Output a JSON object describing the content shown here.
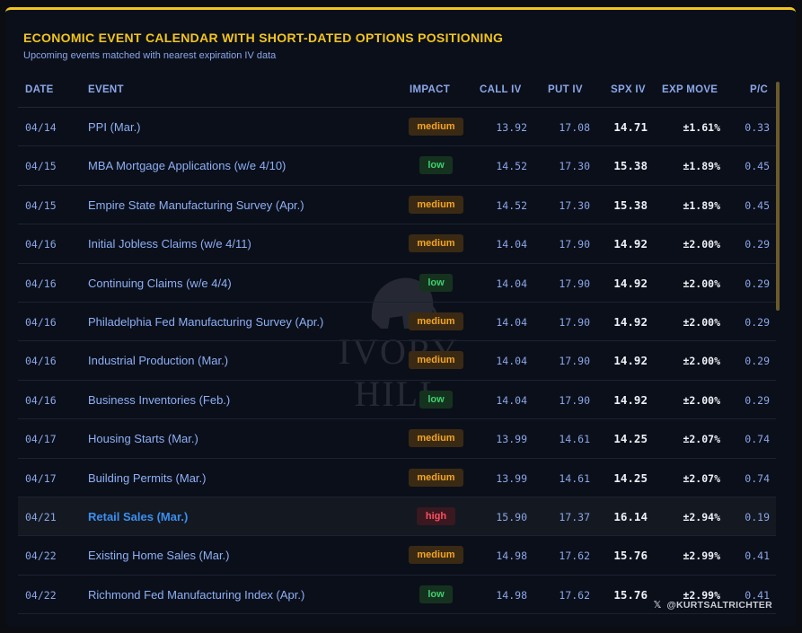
{
  "header": {
    "title": "ECONOMIC EVENT CALENDAR WITH SHORT-DATED OPTIONS POSITIONING",
    "subtitle": "Upcoming events matched with nearest expiration IV data"
  },
  "columns": {
    "date": "DATE",
    "event": "EVENT",
    "impact": "IMPACT",
    "call_iv": "CALL IV",
    "put_iv": "PUT IV",
    "spx_iv": "SPX IV",
    "exp_move": "EXP MOVE",
    "pc": "P/C"
  },
  "rows": [
    {
      "date": "04/14",
      "event": "PPI (Mar.)",
      "impact": "medium",
      "call_iv": "13.92",
      "put_iv": "17.08",
      "spx_iv": "14.71",
      "exp_move": "±1.61%",
      "pc": "0.33"
    },
    {
      "date": "04/15",
      "event": "MBA Mortgage Applications (w/e 4/10)",
      "impact": "low",
      "call_iv": "14.52",
      "put_iv": "17.30",
      "spx_iv": "15.38",
      "exp_move": "±1.89%",
      "pc": "0.45"
    },
    {
      "date": "04/15",
      "event": "Empire State Manufacturing Survey (Apr.)",
      "impact": "medium",
      "call_iv": "14.52",
      "put_iv": "17.30",
      "spx_iv": "15.38",
      "exp_move": "±1.89%",
      "pc": "0.45"
    },
    {
      "date": "04/16",
      "event": "Initial Jobless Claims (w/e 4/11)",
      "impact": "medium",
      "call_iv": "14.04",
      "put_iv": "17.90",
      "spx_iv": "14.92",
      "exp_move": "±2.00%",
      "pc": "0.29"
    },
    {
      "date": "04/16",
      "event": "Continuing Claims (w/e 4/4)",
      "impact": "low",
      "call_iv": "14.04",
      "put_iv": "17.90",
      "spx_iv": "14.92",
      "exp_move": "±2.00%",
      "pc": "0.29"
    },
    {
      "date": "04/16",
      "event": "Philadelphia Fed Manufacturing Survey (Apr.)",
      "impact": "medium",
      "call_iv": "14.04",
      "put_iv": "17.90",
      "spx_iv": "14.92",
      "exp_move": "±2.00%",
      "pc": "0.29"
    },
    {
      "date": "04/16",
      "event": "Industrial Production (Mar.)",
      "impact": "medium",
      "call_iv": "14.04",
      "put_iv": "17.90",
      "spx_iv": "14.92",
      "exp_move": "±2.00%",
      "pc": "0.29"
    },
    {
      "date": "04/16",
      "event": "Business Inventories (Feb.)",
      "impact": "low",
      "call_iv": "14.04",
      "put_iv": "17.90",
      "spx_iv": "14.92",
      "exp_move": "±2.00%",
      "pc": "0.29"
    },
    {
      "date": "04/17",
      "event": "Housing Starts (Mar.)",
      "impact": "medium",
      "call_iv": "13.99",
      "put_iv": "14.61",
      "spx_iv": "14.25",
      "exp_move": "±2.07%",
      "pc": "0.74"
    },
    {
      "date": "04/17",
      "event": "Building Permits (Mar.)",
      "impact": "medium",
      "call_iv": "13.99",
      "put_iv": "14.61",
      "spx_iv": "14.25",
      "exp_move": "±2.07%",
      "pc": "0.74"
    },
    {
      "date": "04/21",
      "event": "Retail Sales (Mar.)",
      "impact": "high",
      "call_iv": "15.90",
      "put_iv": "17.37",
      "spx_iv": "16.14",
      "exp_move": "±2.94%",
      "pc": "0.19",
      "highlight": true
    },
    {
      "date": "04/22",
      "event": "Existing Home Sales (Mar.)",
      "impact": "medium",
      "call_iv": "14.98",
      "put_iv": "17.62",
      "spx_iv": "15.76",
      "exp_move": "±2.99%",
      "pc": "0.41"
    },
    {
      "date": "04/22",
      "event": "Richmond Fed Manufacturing Index (Apr.)",
      "impact": "low",
      "call_iv": "14.98",
      "put_iv": "17.62",
      "spx_iv": "15.76",
      "exp_move": "±2.99%",
      "pc": "0.41"
    }
  ],
  "watermark": {
    "text": "IVORY HILL"
  },
  "credit": {
    "icon": "x-logo-icon",
    "glyph": "𝕏",
    "handle": "@KURTSALTRICHTER"
  },
  "colors": {
    "accent": "#f2c51c",
    "medium": "#f5a524",
    "low": "#3fcf6e",
    "high": "#ff4f60",
    "background": "#0b0f1a"
  }
}
